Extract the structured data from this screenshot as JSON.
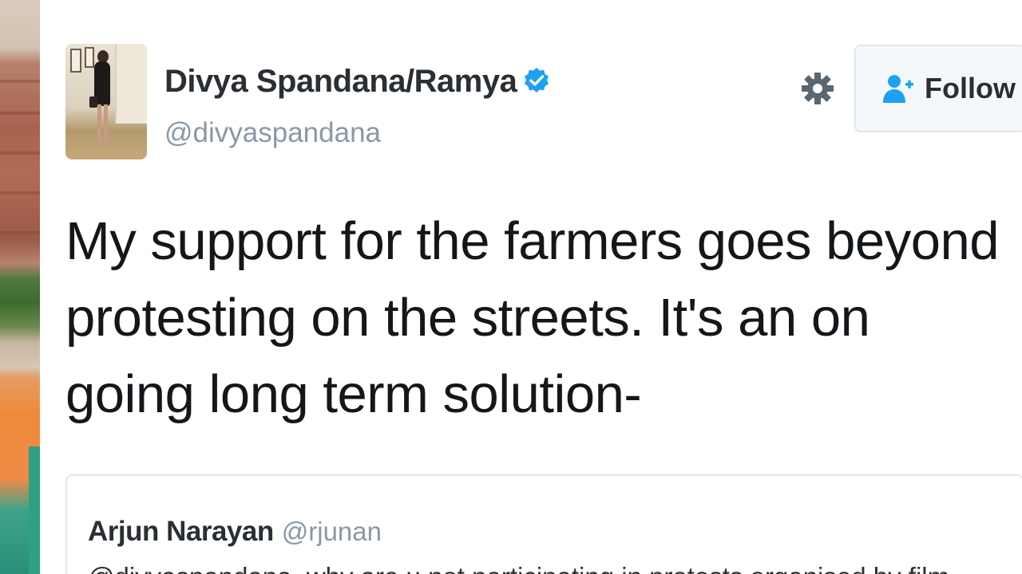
{
  "background": {
    "description_colors": [
      "#a8634f",
      "#3d6b2e",
      "#ee8a45",
      "#2a8f78"
    ]
  },
  "tweet": {
    "author": {
      "display_name": "Divya Spandana/Ramya",
      "handle": "@divyaspandana",
      "verified": true,
      "avatar_icon": "profile-photo"
    },
    "actions": {
      "settings_icon": "gear-icon",
      "follow_label": "Follow",
      "follow_icon": "add-user-icon"
    },
    "text": "My support for the farmers goes beyond protesting on the streets. It's an on going long term solution-",
    "quoted": {
      "display_name": "Arjun Narayan",
      "handle": "@rjunan",
      "text": "@divyaspandana, why are u not participating in protests organised by film"
    }
  },
  "colors": {
    "text_primary": "#292f33",
    "text_secondary": "#8899a6",
    "verified_blue": "#1da1f2",
    "border": "#e1e8ed"
  }
}
